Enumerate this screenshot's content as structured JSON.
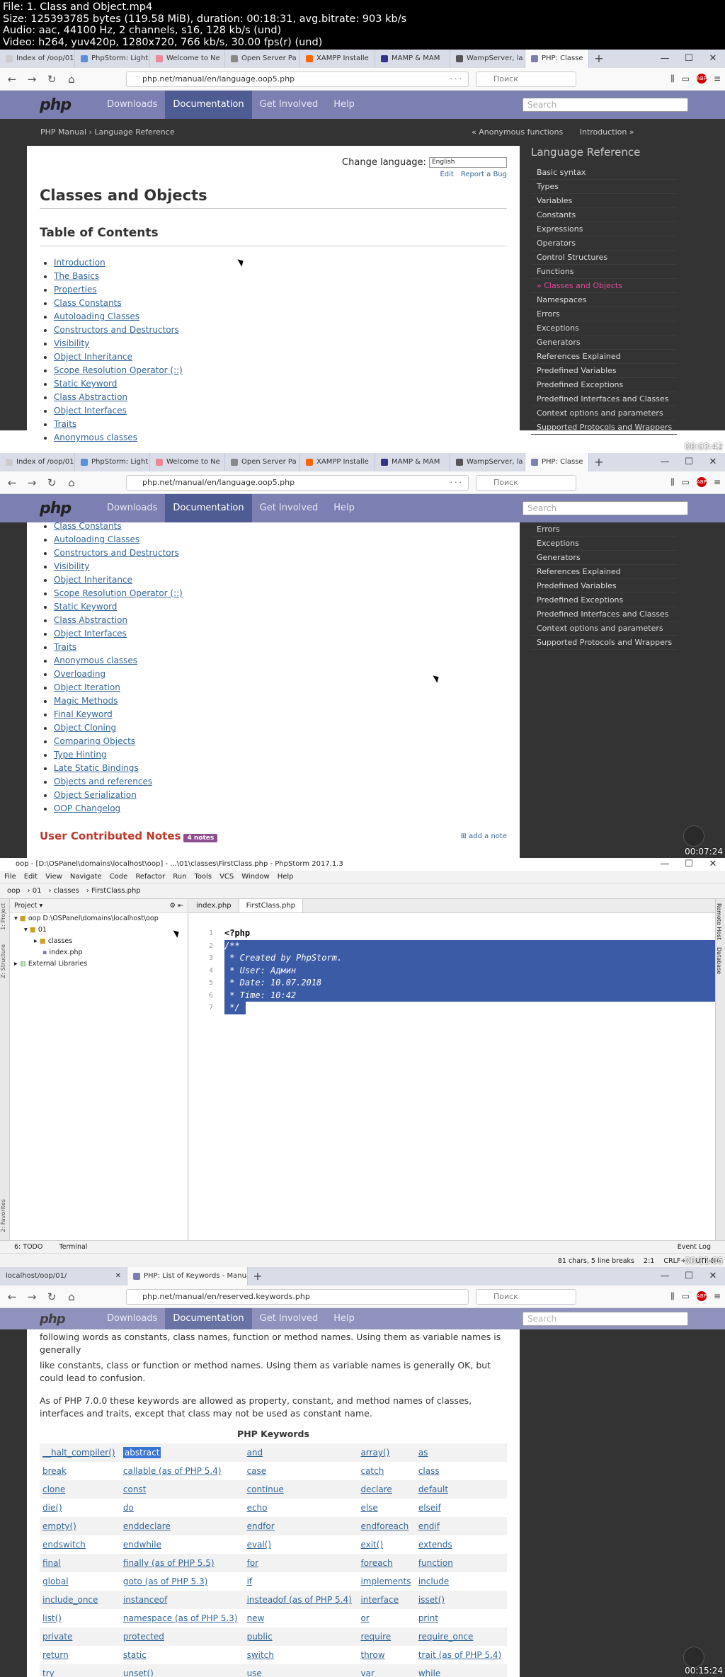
{
  "header": {
    "file": "File: 1. Class and Object.mp4",
    "size": "Size: 125393785 bytes (119.58 MiB), duration: 00:18:31, avg.bitrate: 903 kb/s",
    "audio": "Audio: aac, 44100 Hz, 2 channels, s16, 128 kb/s (und)",
    "video": "Video: h264, yuv420p, 1280x720, 766 kb/s, 30.00 fps(r) (und)"
  },
  "timestamps": [
    "00:03:42",
    "00:07:24",
    "00:11:06",
    "00:15:24"
  ],
  "browser": {
    "tabs": [
      "Index of /oop/01",
      "PhpStorm: Light",
      "Welcome to Ne",
      "Open Server Pa",
      "XAMPP Installe",
      "MAMP & MAM",
      "WampServer, la",
      "PHP: Classe"
    ],
    "url": "php.net/manual/en/language.oop5.php",
    "search_placeholder": "Поиск",
    "page_actions": "···",
    "tabs4": [
      "localhost/oop/01/",
      "PHP: List of Keywords - Manual"
    ],
    "url4": "php.net/manual/en/reserved.keywords.php"
  },
  "php": {
    "logo": "php",
    "nav": [
      "Downloads",
      "Documentation",
      "Get Involved",
      "Help"
    ],
    "search": "Search",
    "crumb_manual": "PHP Manual",
    "crumb_sep": "›",
    "crumb_ref": "Language Reference",
    "prev": "« Anonymous functions",
    "next": "Introduction »",
    "change_language": "Change language:",
    "language": "English",
    "edit": "Edit",
    "report": "Report a Bug",
    "title": "Classes and Objects",
    "toc_title": "Table of Contents",
    "toc": [
      "Introduction",
      "The Basics",
      "Properties",
      "Class Constants",
      "Autoloading Classes",
      "Constructors and Destructors",
      "Visibility",
      "Object Inheritance",
      "Scope Resolution Operator (::)",
      "Static Keyword",
      "Class Abstraction",
      "Object Interfaces",
      "Traits",
      "Anonymous classes"
    ],
    "toc2": [
      "Class Constants",
      "Autoloading Classes",
      "Constructors and Destructors",
      "Visibility",
      "Object Inheritance",
      "Scope Resolution Operator (::)",
      "Static Keyword",
      "Class Abstraction",
      "Object Interfaces",
      "Traits",
      "Anonymous classes",
      "Overloading",
      "Object Iteration",
      "Magic Methods",
      "Final Keyword",
      "Object Cloning",
      "Comparing Objects",
      "Type Hinting",
      "Late Static Bindings",
      "Objects and references",
      "Object Serialization",
      "OOP Changelog"
    ],
    "sidebar_title": "Language Reference",
    "sidebar": [
      "Basic syntax",
      "Types",
      "Variables",
      "Constants",
      "Expressions",
      "Operators",
      "Control Structures",
      "Functions",
      "» Classes and Objects",
      "Namespaces",
      "Errors",
      "Exceptions",
      "Generators",
      "References Explained",
      "Predefined Variables",
      "Predefined Exceptions",
      "Predefined Interfaces and Classes",
      "Context options and parameters",
      "Supported Protocols and Wrappers"
    ],
    "sidebar2": [
      "Errors",
      "Exceptions",
      "Generators",
      "References Explained",
      "Predefined Variables",
      "Predefined Exceptions",
      "Predefined Interfaces and Classes",
      "Context options and parameters",
      "Supported Protocols and Wrappers"
    ],
    "notes_title": "User Contributed Notes",
    "notes_badge": "4 notes",
    "add_note": "add a note"
  },
  "ide": {
    "title": "oop - [D:\\OSPanel\\domains\\localhost\\oop] - ...\\01\\classes\\FirstClass.php - PhpStorm 2017.1.3",
    "menu": [
      "File",
      "Edit",
      "View",
      "Navigate",
      "Code",
      "Refactor",
      "Run",
      "Tools",
      "VCS",
      "Window",
      "Help"
    ],
    "crumbs": [
      "oop",
      "01",
      "classes",
      "FirstClass.php"
    ],
    "project_label": "Project",
    "tree_root": "oop  D:\\OSPanel\\domains\\localhost\\oop",
    "tree_01": "01",
    "tree_classes": "classes",
    "tree_index": "index.php",
    "tree_ext": "External Libraries",
    "tabs": [
      "index.php",
      "FirstClass.php"
    ],
    "lines": [
      "<?php",
      "/**",
      " * Created by PhpStorm.",
      " * User: Админ",
      " * Date: 10.07.2018",
      " * Time: 10:42",
      " */"
    ],
    "line_numbers": [
      "1",
      "2",
      "3",
      "4",
      "5",
      "6",
      "7"
    ],
    "todo": "6: TODO",
    "terminal": "Terminal",
    "event_log": "Event Log",
    "status": [
      "81 chars, 5 line breaks",
      "2:1",
      "CRLF÷",
      "UTF-8÷"
    ],
    "left_strip": [
      "1: Project",
      "Z: Structure",
      "2: Favorites"
    ],
    "right_strip": [
      "Remote Host",
      "Database"
    ]
  },
  "keywords": {
    "intro1": "like constants, class or function or method names. Using them as variable names is generally OK, but could lead to confusion.",
    "intro_top": "following words as constants, class names, function or method names. Using them as variable names is generally",
    "intro2": "As of PHP 7.0.0 these keywords are allowed as property, constant, and method names of classes, interfaces and traits, except that class may not be used as constant name.",
    "table_title": "PHP Keywords",
    "rows": [
      [
        "__halt_compiler()",
        "abstract",
        "and",
        "array()",
        "as"
      ],
      [
        "break",
        "callable (as of PHP 5.4)",
        "case",
        "catch",
        "class"
      ],
      [
        "clone",
        "const",
        "continue",
        "declare",
        "default"
      ],
      [
        "die()",
        "do",
        "echo",
        "else",
        "elseif"
      ],
      [
        "empty()",
        "enddeclare",
        "endfor",
        "endforeach",
        "endif"
      ],
      [
        "endswitch",
        "endwhile",
        "eval()",
        "exit()",
        "extends"
      ],
      [
        "final",
        "finally (as of PHP 5.5)",
        "for",
        "foreach",
        "function"
      ],
      [
        "global",
        "goto (as of PHP 5.3)",
        "if",
        "implements",
        "include"
      ],
      [
        "include_once",
        "instanceof",
        "insteadof (as of PHP 5.4)",
        "interface",
        "isset()"
      ],
      [
        "list()",
        "namespace (as of PHP 5.3)",
        "new",
        "or",
        "print"
      ],
      [
        "private",
        "protected",
        "public",
        "require",
        "require_once"
      ],
      [
        "return",
        "static",
        "switch",
        "throw",
        "trait (as of PHP 5.4)"
      ],
      [
        "try",
        "unset()",
        "use",
        "var",
        "while"
      ]
    ]
  }
}
